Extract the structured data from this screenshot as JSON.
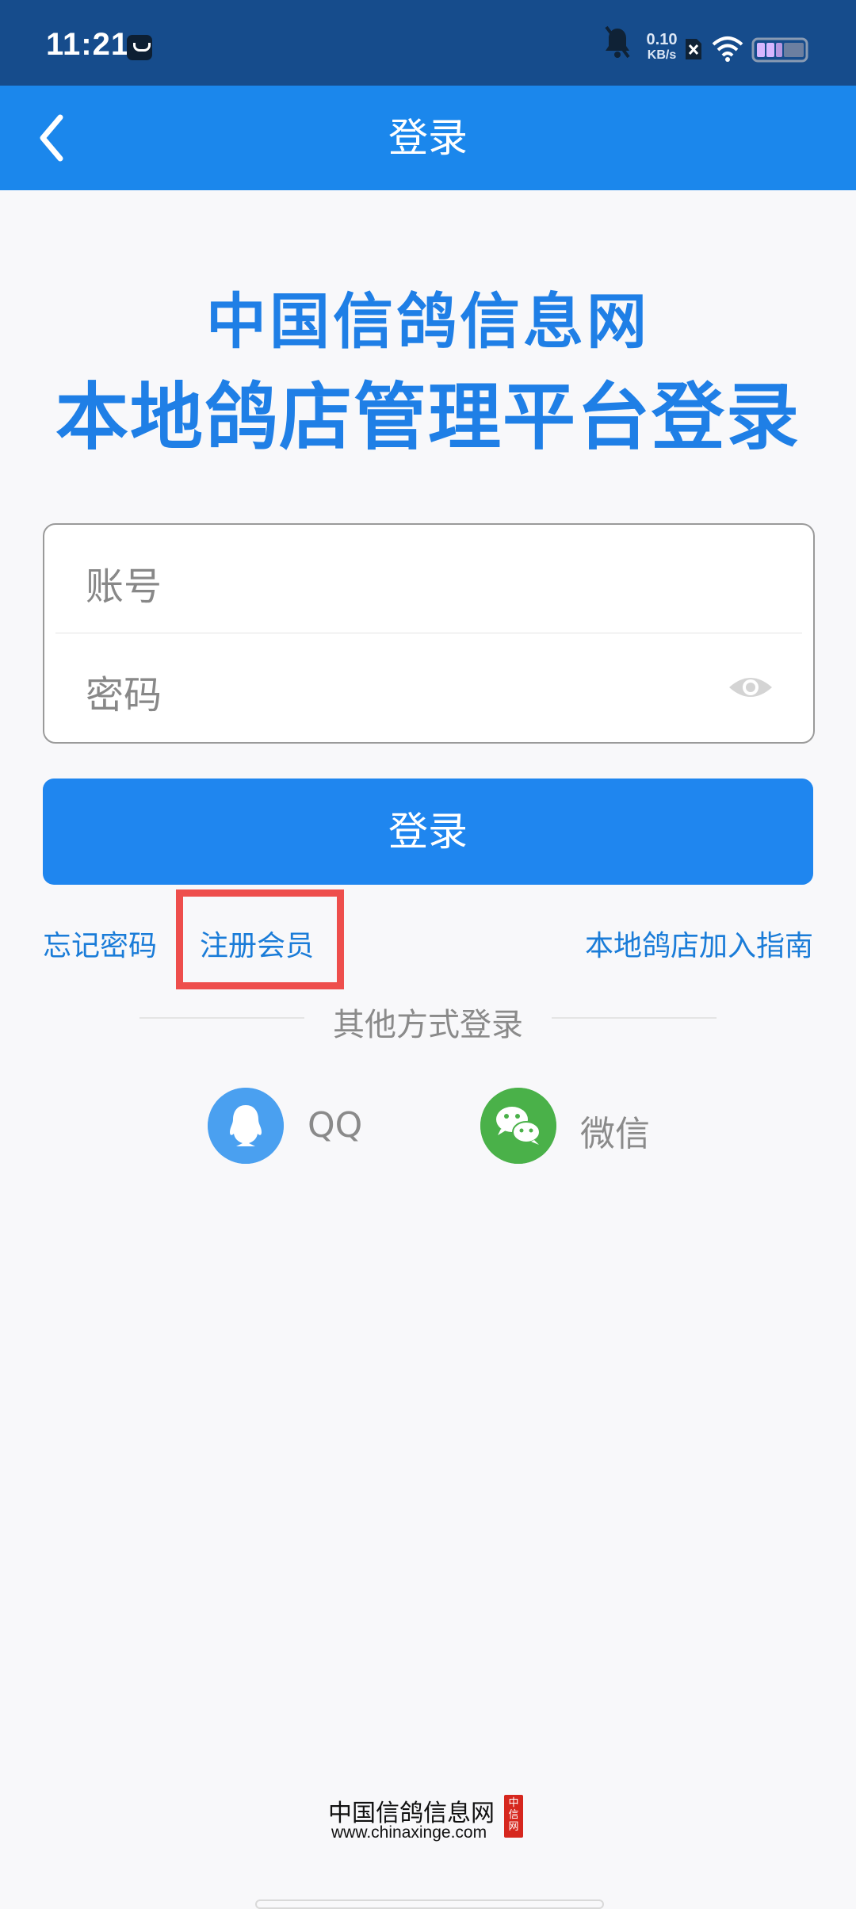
{
  "status_bar": {
    "time": "11:21",
    "net_speed_value": "0.10",
    "net_speed_unit": "KB/s"
  },
  "app_bar": {
    "title": "登录"
  },
  "hero": {
    "line1": "中国信鸽信息网",
    "line2": "本地鸽店管理平台登录"
  },
  "form": {
    "account_placeholder": "账号",
    "password_placeholder": "密码"
  },
  "login_button": "登录",
  "links": {
    "forgot": "忘记密码",
    "register": "注册会员",
    "guide": "本地鸽店加入指南"
  },
  "other_login": {
    "title": "其他方式登录",
    "qq_label": "QQ",
    "wechat_label": "微信"
  },
  "footer": {
    "name": "中国信鸽信息网",
    "url": "www.chinaxinge.com",
    "seal": "中信网"
  },
  "colors": {
    "status_bar": "#164c8c",
    "accent": "#1b87ec",
    "highlight_box": "#ee4e4c",
    "qq": "#4aa0f0",
    "wechat": "#4ab149"
  }
}
